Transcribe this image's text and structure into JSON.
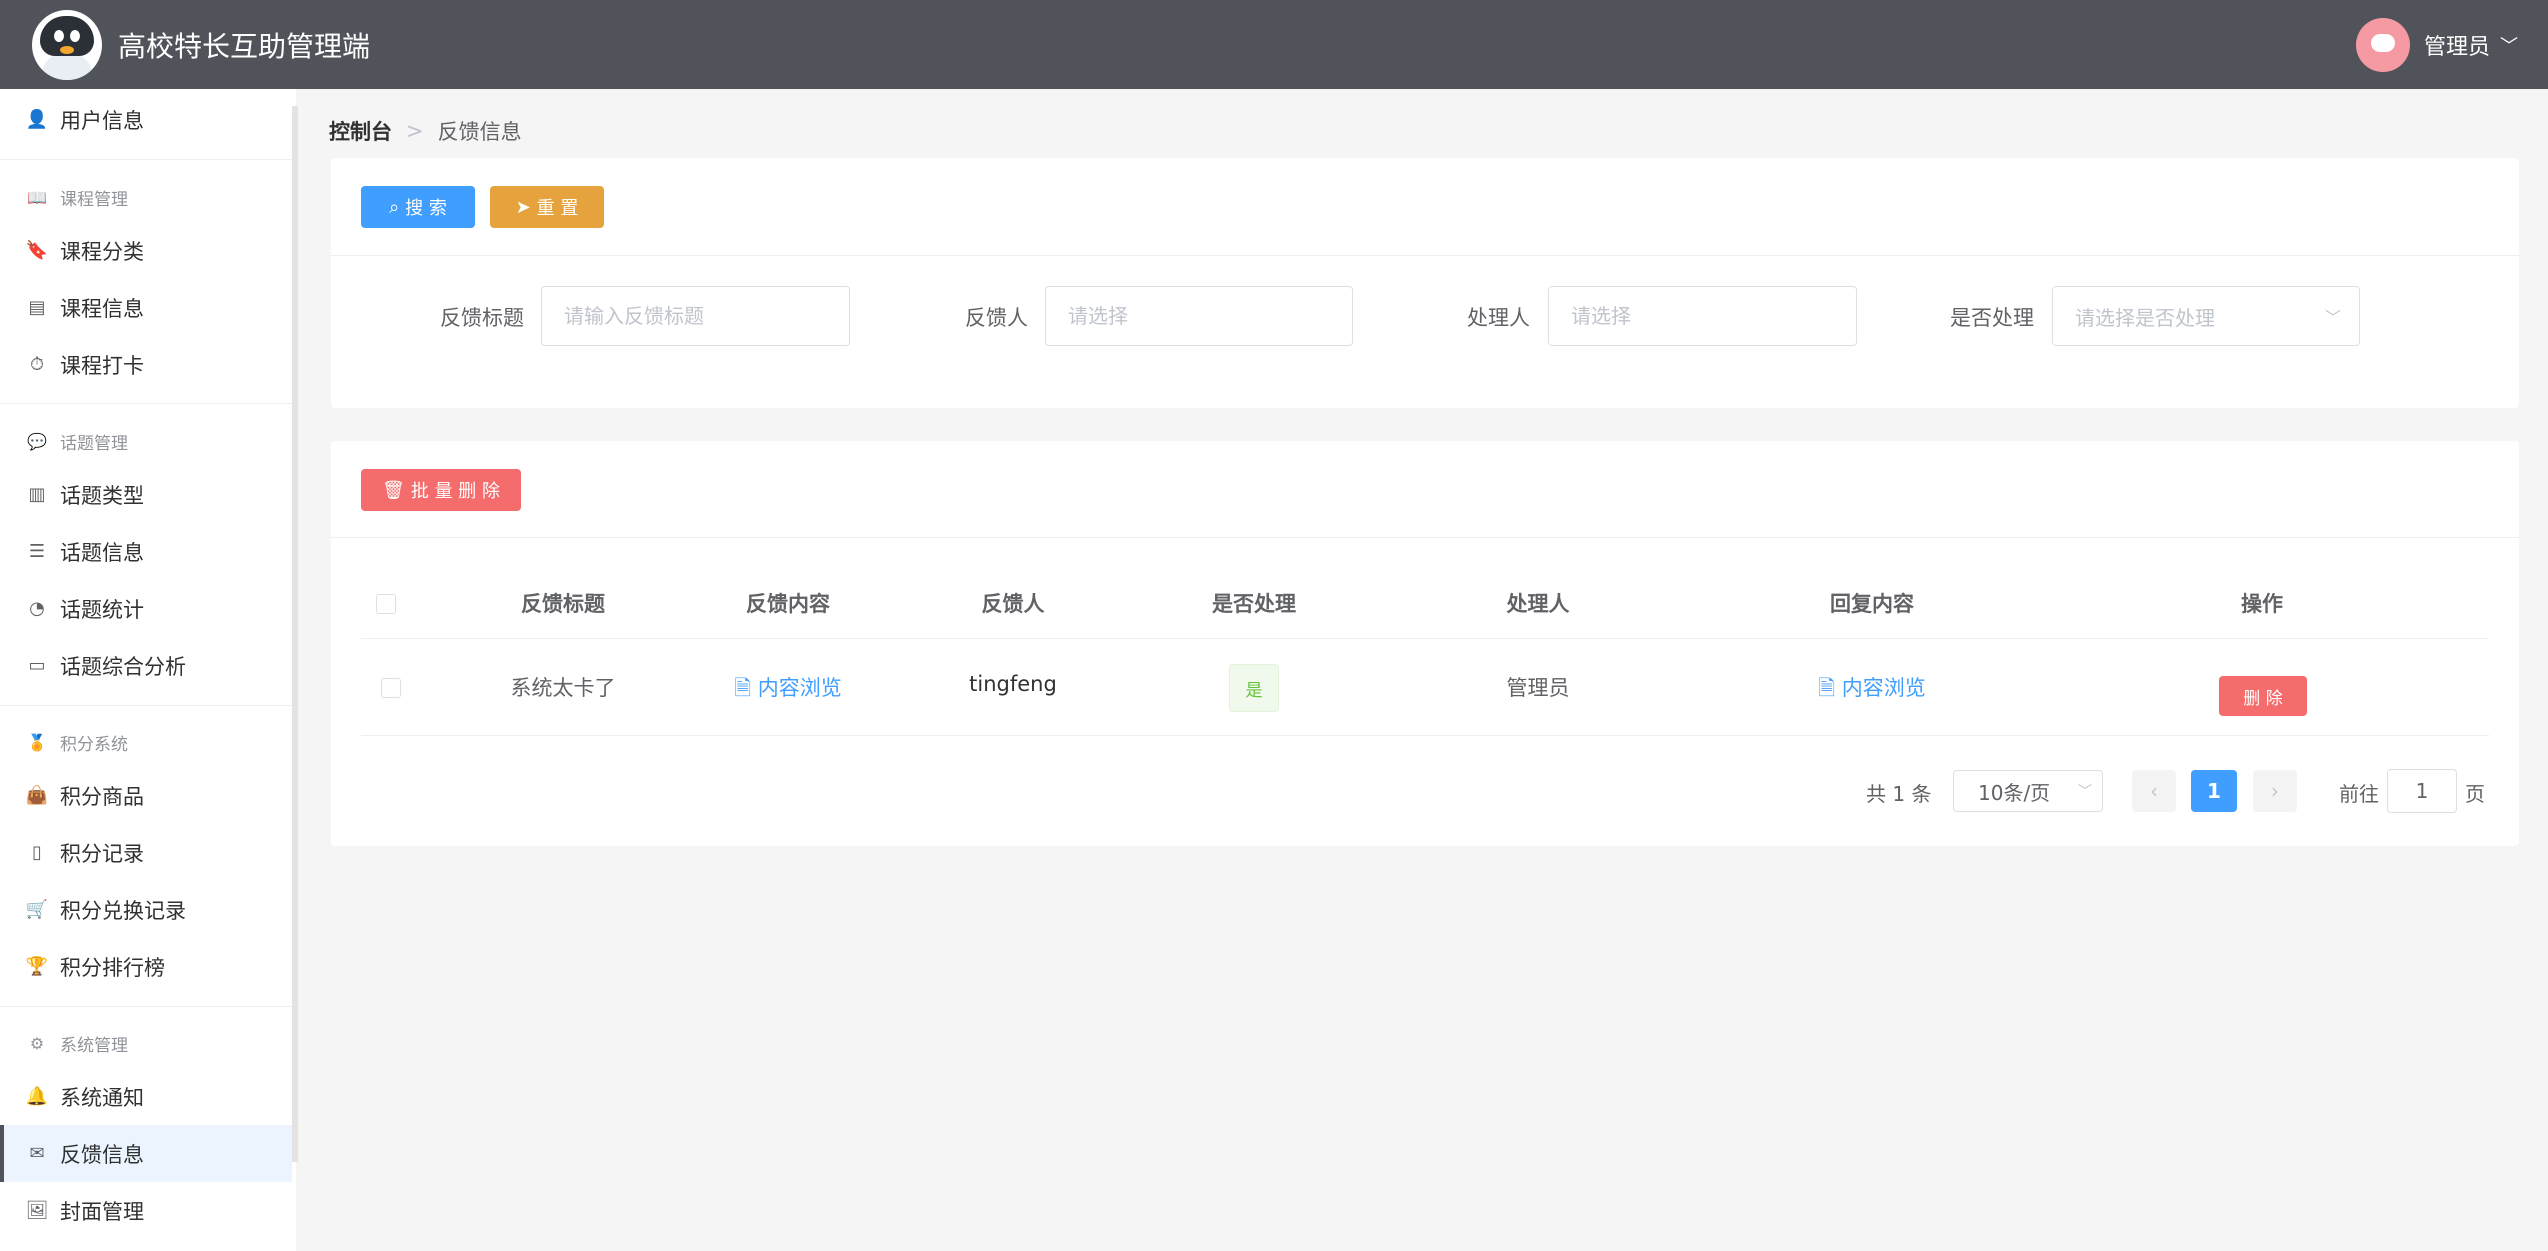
{
  "app": {
    "title": "高校特长互助管理端"
  },
  "user": {
    "name": "管理员"
  },
  "sidebar": {
    "user_info": "用户信息",
    "groups": [
      {
        "label": "课程管理",
        "items": [
          "课程分类",
          "课程信息",
          "课程打卡"
        ]
      },
      {
        "label": "话题管理",
        "items": [
          "话题类型",
          "话题信息",
          "话题统计",
          "话题综合分析"
        ]
      },
      {
        "label": "积分系统",
        "items": [
          "积分商品",
          "积分记录",
          "积分兑换记录",
          "积分排行榜"
        ]
      },
      {
        "label": "系统管理",
        "items": [
          "系统通知",
          "反馈信息",
          "封面管理"
        ]
      }
    ],
    "active": "反馈信息"
  },
  "breadcrumb": {
    "root": "控制台",
    "current": "反馈信息"
  },
  "search": {
    "search_button": "搜 索",
    "reset_button": "重 置",
    "fields": {
      "title_label": "反馈标题",
      "title_placeholder": "请输入反馈标题",
      "feedbacker_label": "反馈人",
      "feedbacker_placeholder": "请选择",
      "handler_label": "处理人",
      "handler_placeholder": "请选择",
      "processed_label": "是否处理",
      "processed_placeholder": "请选择是否处理"
    }
  },
  "table": {
    "batch_delete": "批 量 删 除",
    "columns": [
      "反馈标题",
      "反馈内容",
      "反馈人",
      "是否处理",
      "处理人",
      "回复内容",
      "操作"
    ],
    "rows": [
      {
        "title": "系统太卡了",
        "content": "内容浏览",
        "feedbacker": "tingfeng",
        "processed": "是",
        "handler": "管理员",
        "reply": "内容浏览",
        "action": "删 除"
      }
    ]
  },
  "pagination": {
    "total": "共 1 条",
    "page_size": "10条/页",
    "current_page": "1",
    "goto_label": "前往",
    "goto_value": "1",
    "page_suffix": "页"
  },
  "colors": {
    "primary": "#409eff",
    "warning": "#e6a23c",
    "danger": "#f56c6c",
    "success": "#67c23a",
    "header": "#50545a"
  }
}
